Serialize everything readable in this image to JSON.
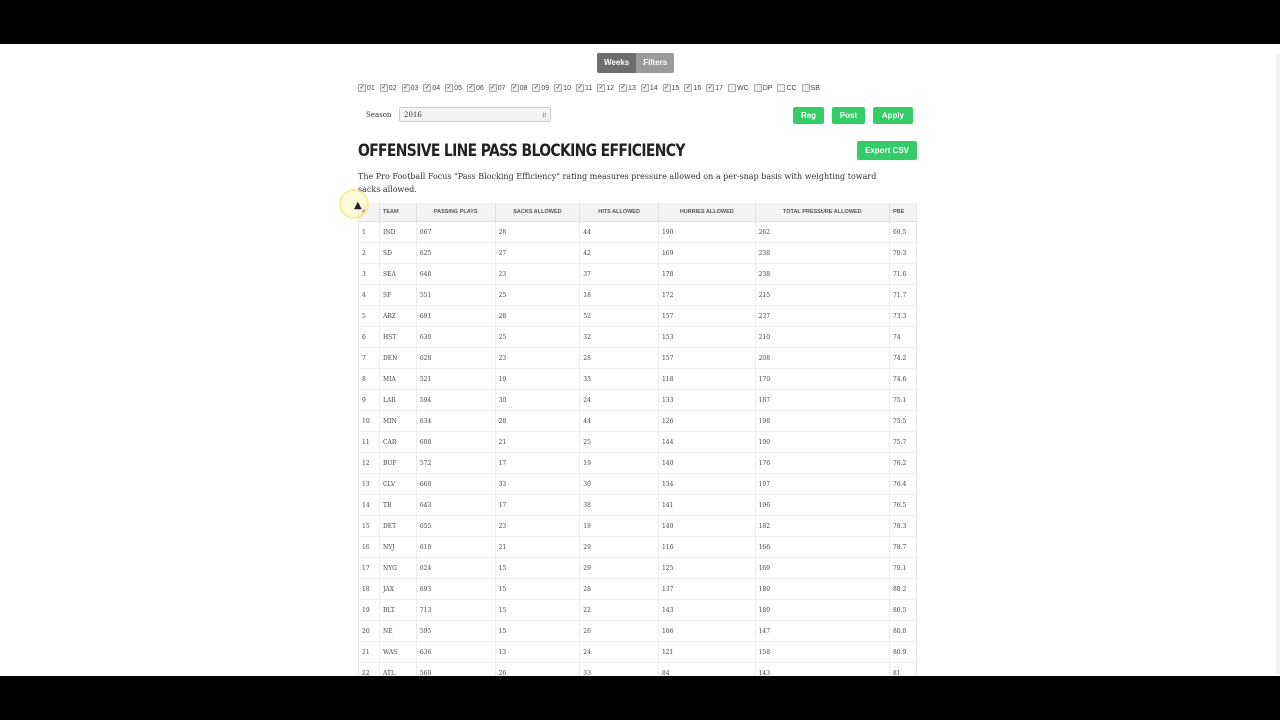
{
  "toggle": {
    "weeks": "Weeks",
    "filters": "Filters"
  },
  "weeks": [
    {
      "label": "01",
      "checked": true
    },
    {
      "label": "02",
      "checked": true
    },
    {
      "label": "03",
      "checked": true
    },
    {
      "label": "04",
      "checked": true
    },
    {
      "label": "05",
      "checked": true
    },
    {
      "label": "06",
      "checked": true
    },
    {
      "label": "07",
      "checked": true
    },
    {
      "label": "08",
      "checked": true
    },
    {
      "label": "09",
      "checked": true
    },
    {
      "label": "10",
      "checked": true
    },
    {
      "label": "11",
      "checked": true
    },
    {
      "label": "12",
      "checked": true
    },
    {
      "label": "13",
      "checked": true
    },
    {
      "label": "14",
      "checked": true
    },
    {
      "label": "15",
      "checked": true
    },
    {
      "label": "16",
      "checked": true
    },
    {
      "label": "17",
      "checked": true
    },
    {
      "label": "WC",
      "checked": false
    },
    {
      "label": "DP",
      "checked": false
    },
    {
      "label": "CC",
      "checked": false
    },
    {
      "label": "SB",
      "checked": false
    }
  ],
  "season": {
    "label": "Season",
    "value": "2016"
  },
  "buttons": {
    "reg": "Reg",
    "post": "Post",
    "apply": "Apply",
    "export": "Export CSV"
  },
  "title": "OFFENSIVE LINE PASS BLOCKING EFFICIENCY",
  "description": "The Pro Football Focus \"Pass Blocking Efficiency\" rating measures pressure allowed on a per-snap basis with weighting toward sacks allowed.",
  "table": {
    "headers": [
      "#",
      "TEAM",
      "PASSING PLAYS",
      "SACKS ALLOWED",
      "HITS ALLOWED",
      "HURRIES ALLOWED",
      "TOTAL PRESSURE ALLOWED",
      "PBE"
    ],
    "rows": [
      [
        "1",
        "IND",
        "667",
        "28",
        "44",
        "190",
        "262",
        "69.5"
      ],
      [
        "2",
        "SD",
        "625",
        "27",
        "42",
        "169",
        "238",
        "70.3"
      ],
      [
        "3",
        "SEA",
        "648",
        "23",
        "37",
        "178",
        "238",
        "71.6"
      ],
      [
        "4",
        "SF",
        "551",
        "25",
        "18",
        "172",
        "215",
        "71.7"
      ],
      [
        "5",
        "ARZ",
        "691",
        "28",
        "52",
        "157",
        "237",
        "73.3"
      ],
      [
        "6",
        "HST",
        "630",
        "25",
        "32",
        "153",
        "210",
        "74"
      ],
      [
        "7",
        "DEN",
        "628",
        "23",
        "28",
        "157",
        "208",
        "74.2"
      ],
      [
        "8",
        "MIA",
        "521",
        "19",
        "33",
        "118",
        "170",
        "74.6"
      ],
      [
        "9",
        "LAR",
        "594",
        "30",
        "24",
        "133",
        "187",
        "75.1"
      ],
      [
        "10",
        "MIN",
        "634",
        "28",
        "44",
        "126",
        "198",
        "75.5"
      ],
      [
        "11",
        "CAR",
        "608",
        "21",
        "25",
        "144",
        "190",
        "75.7"
      ],
      [
        "12",
        "BUF",
        "572",
        "17",
        "19",
        "140",
        "176",
        "76.2"
      ],
      [
        "13",
        "CLV",
        "660",
        "33",
        "30",
        "134",
        "197",
        "76.4"
      ],
      [
        "14",
        "TB",
        "643",
        "17",
        "38",
        "141",
        "196",
        "76.5"
      ],
      [
        "15",
        "DET",
        "655",
        "23",
        "19",
        "140",
        "182",
        "78.3"
      ],
      [
        "16",
        "NYJ",
        "610",
        "21",
        "29",
        "116",
        "166",
        "78.7"
      ],
      [
        "17",
        "NYG",
        "624",
        "15",
        "29",
        "125",
        "169",
        "79.1"
      ],
      [
        "18",
        "JAX",
        "693",
        "15",
        "28",
        "137",
        "180",
        "80.2"
      ],
      [
        "19",
        "BLT",
        "713",
        "15",
        "22",
        "143",
        "180",
        "80.5"
      ],
      [
        "20",
        "NE",
        "595",
        "15",
        "26",
        "106",
        "147",
        "80.8"
      ],
      [
        "21",
        "WAS",
        "636",
        "13",
        "24",
        "121",
        "158",
        "80.9"
      ],
      [
        "22",
        "ATL",
        "560",
        "26",
        "33",
        "84",
        "143",
        "81"
      ]
    ]
  }
}
